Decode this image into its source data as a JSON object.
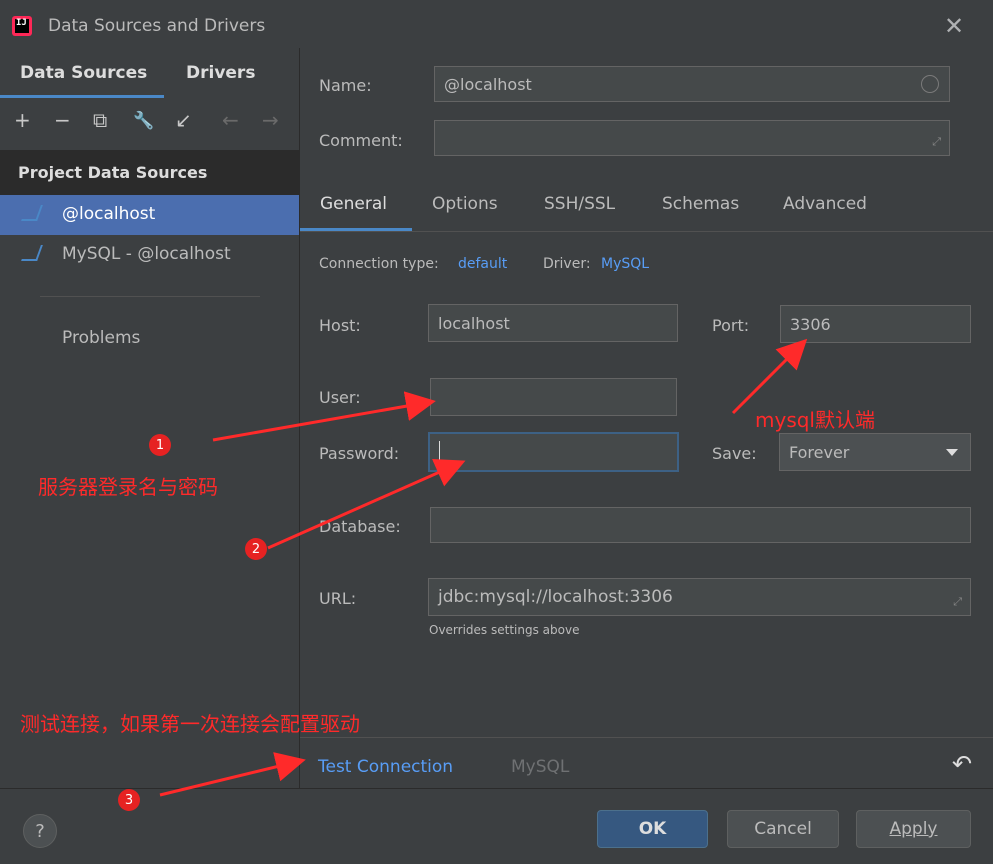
{
  "window": {
    "app_icon_text": "IJ",
    "title": "Data Sources and Drivers",
    "close_glyph": "✕"
  },
  "left": {
    "tabs": [
      {
        "label": "Data Sources",
        "active": true
      },
      {
        "label": "Drivers",
        "active": false
      }
    ],
    "toolbar": [
      {
        "icon": "add-icon",
        "glyph": "+"
      },
      {
        "icon": "remove-icon",
        "glyph": "−"
      },
      {
        "icon": "duplicate-icon",
        "glyph": "⧉"
      },
      {
        "icon": "wrench-icon",
        "glyph": "🔧"
      },
      {
        "icon": "import-icon",
        "glyph": "↙"
      },
      {
        "icon": "back-icon",
        "glyph": "←"
      },
      {
        "icon": "forward-icon",
        "glyph": "→"
      }
    ],
    "section_header": "Project Data Sources",
    "items": [
      {
        "label": "@localhost",
        "selected": true
      },
      {
        "label": "MySQL - @localhost",
        "selected": false
      }
    ],
    "problems": "Problems"
  },
  "form": {
    "name_label": "Name:",
    "name_value": "@localhost",
    "comment_label": "Comment:",
    "comment_value": "",
    "tabs": [
      "General",
      "Options",
      "SSH/SSL",
      "Schemas",
      "Advanced"
    ],
    "connection_type_label": "Connection type:",
    "connection_type_value": "default",
    "driver_label": "Driver:",
    "driver_value": "MySQL",
    "host_label": "Host:",
    "host_value": "localhost",
    "port_label": "Port:",
    "port_value": "3306",
    "user_label": "User:",
    "user_value": "",
    "password_label": "Password:",
    "password_value": "",
    "save_label": "Save:",
    "save_value": "Forever",
    "database_label": "Database:",
    "database_value": "",
    "url_label": "URL:",
    "url_value": "jdbc:mysql://localhost:3306",
    "url_hint": "Overrides settings above"
  },
  "bottom": {
    "test_connection": "Test Connection",
    "driver_name": "MySQL",
    "revert_glyph": "↶"
  },
  "footer": {
    "help": "?",
    "ok": "OK",
    "cancel": "Cancel",
    "apply": "Apply"
  },
  "annotations": {
    "mysql_default_port": "mysql默认端",
    "badge1": "1",
    "login_note": "服务器登录名与密码",
    "badge2": "2",
    "test_note": "测试连接，如果第一次连接会配置驱动",
    "badge3": "3"
  },
  "colors": {
    "background": "#3c3f41",
    "accent": "#4a88c7",
    "link": "#589df6",
    "selection": "#4b6eaf",
    "annotation": "#ff2a2a"
  }
}
